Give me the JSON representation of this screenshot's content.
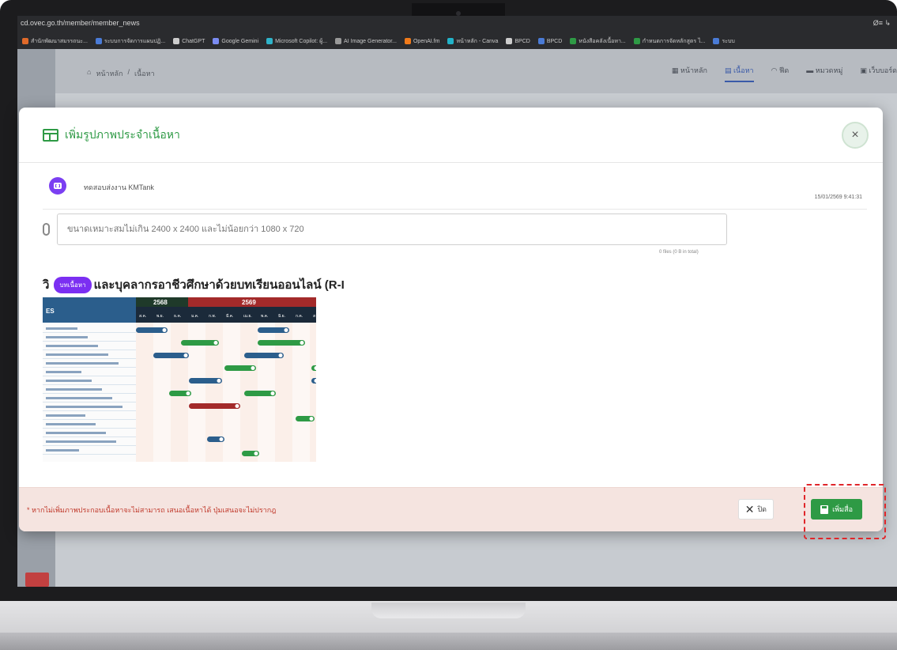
{
  "browser": {
    "url": "cd.ovec.go.th/member/member_news",
    "right_indicator": "Ø≡ ↳",
    "bookmarks": [
      {
        "label": "สำนักพัฒนาสมรรถนะ...",
        "color": "#e06a2a"
      },
      {
        "label": "ระบบการจัดการแผนปฏิ...",
        "color": "#4a7bd6"
      },
      {
        "label": "ChatGPT",
        "color": "#cccccc"
      },
      {
        "label": "Google Gemini",
        "color": "#7b8cf2"
      },
      {
        "label": "Microsoft Copilot: ผู้...",
        "color": "#2fb3c9"
      },
      {
        "label": "AI Image Generator...",
        "color": "#999999"
      },
      {
        "label": "OpenAI.fm",
        "color": "#f07a1a"
      },
      {
        "label": "หน้าหลัก - Canva",
        "color": "#22b3c9"
      },
      {
        "label": "BPCD",
        "color": "#cccccc"
      },
      {
        "label": "BPCD",
        "color": "#4a7bd6"
      },
      {
        "label": "หนังสือคลังเนื้อหา...",
        "color": "#2e9a45"
      },
      {
        "label": "กำหนดการจัดหลักสูตร ไ...",
        "color": "#2e9a45"
      },
      {
        "label": "ระบบ",
        "color": "#4a7bd6"
      }
    ]
  },
  "app": {
    "breadcrumb": {
      "home": "หน้าหลัก",
      "separator": "/",
      "current": "เนื้อหา"
    },
    "nav": [
      {
        "label": "หน้าหลัก",
        "active": false
      },
      {
        "label": "เนื้อหา",
        "active": true
      },
      {
        "label": "ฟีด",
        "active": false
      },
      {
        "label": "หมวดหมู่",
        "active": false
      },
      {
        "label": "เว็บบอร์ด",
        "active": false
      }
    ]
  },
  "modal": {
    "title": "เพิ่มรูปภาพประจำเนื้อหา",
    "close_label": "×",
    "post": {
      "name": "ทดสอบส่งงาน KMTank",
      "timestamp": "15/01/2569 9:41:31"
    },
    "file_input": {
      "placeholder": "ขนาดเหมาะสมไม่เกิน 2400 x 2400 และไม่น้อยกว่า 1080 x 720",
      "file_count": "0 files (0 B in total)"
    },
    "preview": {
      "title_prefix": "วิ",
      "tag": "บทเนื้อหา",
      "title_suffix": "และบุคลากรอาชีวศึกษาด้วยบทเรียนออนไลน์ (R-I"
    },
    "footer": {
      "note": "* หากไม่เพิ่มภาพประกอบเนื้อหาจะไม่สามารถ เสนอเนื้อหาได้ ปุ่มเสนอจะไม่ปรากฎ",
      "cancel_label": "ปิด",
      "add_label": "เพิ่มสื่อ"
    }
  },
  "gantt": {
    "years": [
      {
        "label": "2568",
        "color": "#1f3a2a"
      },
      {
        "label": "2569",
        "color": "#a32a2a"
      }
    ],
    "months": [
      "ส.ค.",
      "พ.ย.",
      "ธ.ค.",
      "ม.ค.",
      "ก.พ.",
      "มี.ค.",
      "เม.ย.",
      "พ.ค.",
      "มิ.ย.",
      "ก.ค.",
      "ส"
    ],
    "header_label": "ES"
  }
}
